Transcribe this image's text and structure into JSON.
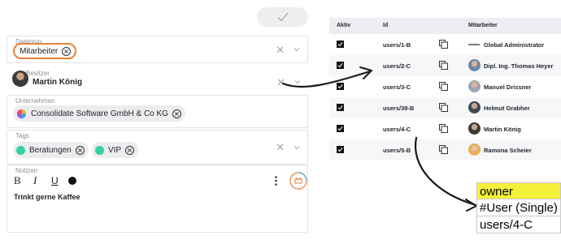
{
  "form": {
    "save_icon": "checkmark-icon",
    "fields": {
      "datatype": {
        "label": "Datentyp",
        "value": "Mitarbeiter"
      },
      "owner": {
        "label": "Besitzer",
        "value": "Martin König"
      },
      "company": {
        "label": "Unternehmen",
        "value": "Consolidate Software GmbH & Co KG"
      },
      "tags": {
        "label": "Tags",
        "items": [
          "Beratungen",
          "VIP"
        ]
      },
      "notes": {
        "label": "Notizen",
        "text": "Trinkt gerne Kaffee",
        "toolbar": [
          "B",
          "I",
          "U"
        ]
      }
    }
  },
  "table": {
    "headers": {
      "active": "Aktiv",
      "id": "Id",
      "employee": "Mitarbeiter"
    },
    "rows": [
      {
        "active": true,
        "id": "users/1-B",
        "name": "Global Administrator"
      },
      {
        "active": true,
        "id": "users/2-C",
        "name": "Dipl. Ing. Thomas Heyer"
      },
      {
        "active": true,
        "id": "users/3-C",
        "name": "Manuel Drissner"
      },
      {
        "active": true,
        "id": "users/39-B",
        "name": "Helmut Grabher"
      },
      {
        "active": true,
        "id": "users/4-C",
        "name": "Martin König"
      },
      {
        "active": true,
        "id": "users/5-B",
        "name": "Ramona Scheier"
      }
    ]
  },
  "annotation": {
    "lines": [
      "owner",
      "#User (Single)",
      "users/4-C"
    ],
    "highlight_color": "#f5f03a"
  },
  "colors": {
    "accent_orange": "#e8823a",
    "tag_green": "#33d1a4",
    "chip_bg": "#ececee"
  }
}
